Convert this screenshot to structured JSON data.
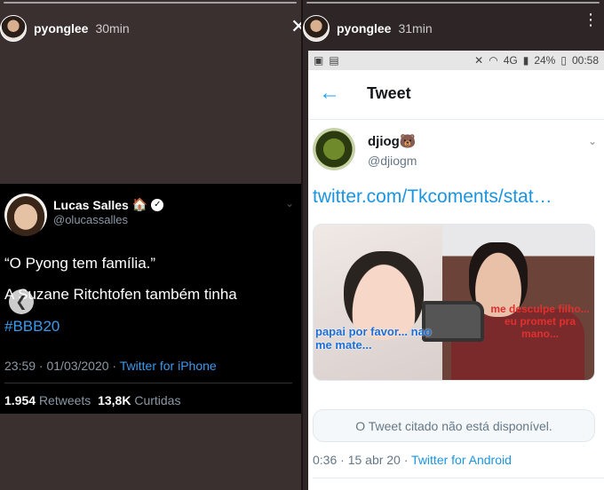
{
  "left_story": {
    "user": "pyonglee",
    "time": "30min",
    "tweet": {
      "name": "Lucas Salles",
      "name_emoji": "🏠",
      "handle": "@olucassalles",
      "line1": "“O Pyong tem família.”",
      "line2": "A Suzane Ritchtofen também tinha",
      "hashtag": "#BBB20",
      "datetime": "23:59 · 01/03/2020 ·",
      "source": "Twitter for iPhone",
      "retweets_count": "1.954",
      "retweets_label": "Retweets",
      "likes_count": "13,8K",
      "likes_label": "Curtidas"
    }
  },
  "right_story": {
    "user": "pyonglee",
    "time": "31min",
    "statusbar": {
      "battery": "24%",
      "clock": "00:58",
      "network": "4G"
    },
    "appbar_title": "Tweet",
    "tweet": {
      "name": "djiog",
      "name_emoji": "🐻",
      "handle": "@djiogm",
      "link": "twitter.com/Tkcoments/stat…",
      "caption_left": "papai por favor... nao me mate...",
      "caption_right": "me desculpe filho... eu promet pra mano...",
      "quoted_unavailable": "O Tweet citado não está disponível.",
      "datetime": "0:36 · 15 abr 20 ·",
      "source": "Twitter for Android"
    }
  },
  "colors": {
    "twitter_blue": "#1da1f2",
    "dark_tweet_bg": "#000000",
    "story_bg": "#3a302f"
  }
}
